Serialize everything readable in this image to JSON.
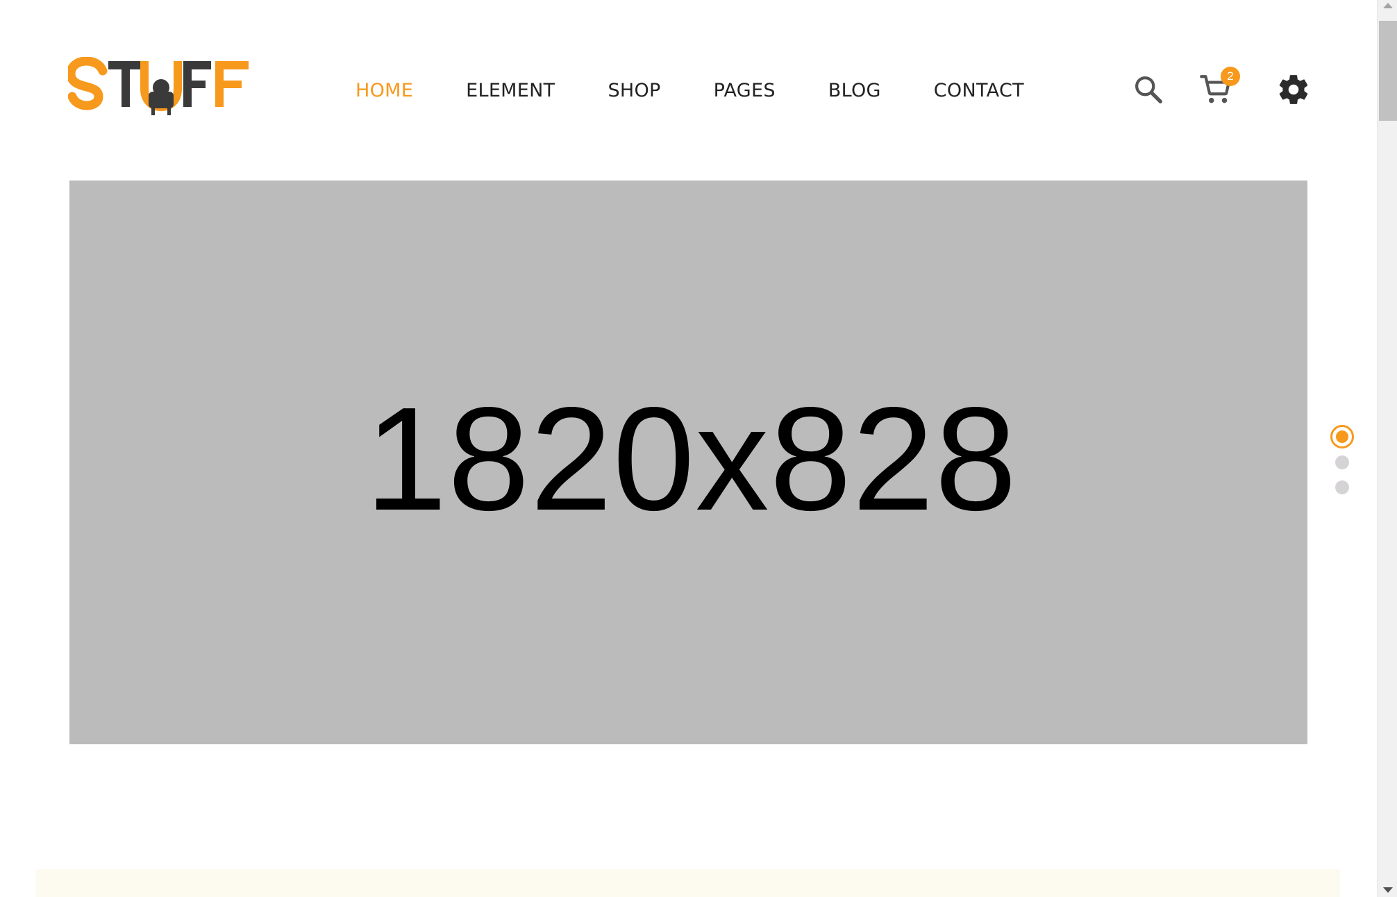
{
  "brand": {
    "logo_text": "STUFF",
    "accent_color": "#f7991c",
    "dark_color": "#3a3a3a"
  },
  "nav": {
    "items": [
      {
        "label": "HOME",
        "active": true
      },
      {
        "label": "ELEMENT",
        "active": false
      },
      {
        "label": "SHOP",
        "active": false
      },
      {
        "label": "PAGES",
        "active": false
      },
      {
        "label": "BLOG",
        "active": false
      },
      {
        "label": "CONTACT",
        "active": false
      }
    ]
  },
  "header_actions": {
    "search_icon": "search-icon",
    "cart_icon": "cart-icon",
    "cart_count": "2",
    "settings_icon": "gear-icon"
  },
  "hero": {
    "placeholder_text": "1820x828",
    "background": "#bbbbbb"
  },
  "slider": {
    "dot_count": 3,
    "active_index": 0,
    "inactive_color": "#d6d3d6"
  }
}
